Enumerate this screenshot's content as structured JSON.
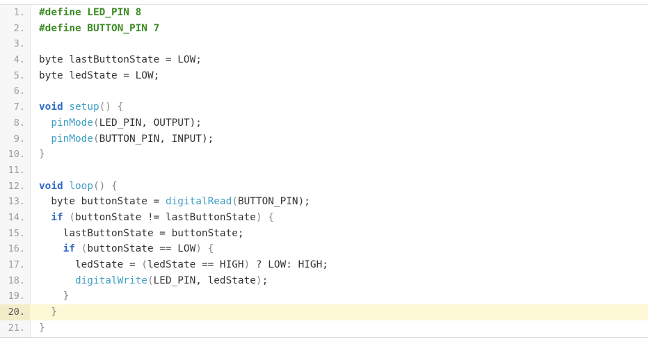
{
  "editor": {
    "active_line": 20,
    "lines": [
      {
        "n": "1.",
        "tokens": [
          {
            "t": "#define LED_PIN 8",
            "c": "dir"
          }
        ]
      },
      {
        "n": "2.",
        "tokens": [
          {
            "t": "#define BUTTON_PIN 7",
            "c": "dir"
          }
        ]
      },
      {
        "n": "3.",
        "tokens": []
      },
      {
        "n": "4.",
        "tokens": [
          {
            "t": "byte lastButtonState = LOW;",
            "c": "plain"
          }
        ]
      },
      {
        "n": "5.",
        "tokens": [
          {
            "t": "byte ledState = LOW;",
            "c": "plain"
          }
        ]
      },
      {
        "n": "6.",
        "tokens": []
      },
      {
        "n": "7.",
        "tokens": [
          {
            "t": "void",
            "c": "kw"
          },
          {
            "t": " ",
            "c": "plain"
          },
          {
            "t": "setup",
            "c": "fn"
          },
          {
            "t": "() {",
            "c": "p"
          }
        ]
      },
      {
        "n": "8.",
        "tokens": [
          {
            "t": "  ",
            "c": "plain"
          },
          {
            "t": "pinMode",
            "c": "fn"
          },
          {
            "t": "(",
            "c": "p"
          },
          {
            "t": "LED_PIN, OUTPUT",
            "c": "plain"
          },
          {
            "t": ");",
            "c": "plain"
          }
        ]
      },
      {
        "n": "9.",
        "tokens": [
          {
            "t": "  ",
            "c": "plain"
          },
          {
            "t": "pinMode",
            "c": "fn"
          },
          {
            "t": "(",
            "c": "p"
          },
          {
            "t": "BUTTON_PIN, INPUT",
            "c": "plain"
          },
          {
            "t": ");",
            "c": "plain"
          }
        ]
      },
      {
        "n": "10.",
        "tokens": [
          {
            "t": "}",
            "c": "p"
          }
        ]
      },
      {
        "n": "11.",
        "tokens": []
      },
      {
        "n": "12.",
        "tokens": [
          {
            "t": "void",
            "c": "kw"
          },
          {
            "t": " ",
            "c": "plain"
          },
          {
            "t": "loop",
            "c": "fn"
          },
          {
            "t": "() {",
            "c": "p"
          }
        ]
      },
      {
        "n": "13.",
        "tokens": [
          {
            "t": "  byte buttonState = ",
            "c": "plain"
          },
          {
            "t": "digitalRead",
            "c": "fn"
          },
          {
            "t": "(",
            "c": "p"
          },
          {
            "t": "BUTTON_PIN",
            "c": "plain"
          },
          {
            "t": ");",
            "c": "plain"
          }
        ]
      },
      {
        "n": "14.",
        "tokens": [
          {
            "t": "  ",
            "c": "plain"
          },
          {
            "t": "if",
            "c": "kw"
          },
          {
            "t": " (",
            "c": "p"
          },
          {
            "t": "buttonState != lastButtonState",
            "c": "plain"
          },
          {
            "t": ") {",
            "c": "p"
          }
        ]
      },
      {
        "n": "15.",
        "tokens": [
          {
            "t": "    lastButtonState = buttonState;",
            "c": "plain"
          }
        ]
      },
      {
        "n": "16.",
        "tokens": [
          {
            "t": "    ",
            "c": "plain"
          },
          {
            "t": "if",
            "c": "kw"
          },
          {
            "t": " (",
            "c": "p"
          },
          {
            "t": "buttonState == LOW",
            "c": "plain"
          },
          {
            "t": ") {",
            "c": "p"
          }
        ]
      },
      {
        "n": "17.",
        "tokens": [
          {
            "t": "      ledState = ",
            "c": "plain"
          },
          {
            "t": "(",
            "c": "p"
          },
          {
            "t": "ledState == HIGH",
            "c": "plain"
          },
          {
            "t": ")",
            "c": "p"
          },
          {
            "t": " ? LOW: HIGH;",
            "c": "plain"
          }
        ]
      },
      {
        "n": "18.",
        "tokens": [
          {
            "t": "      ",
            "c": "plain"
          },
          {
            "t": "digitalWrite",
            "c": "fn"
          },
          {
            "t": "(",
            "c": "p"
          },
          {
            "t": "LED_PIN, ledState",
            "c": "plain"
          },
          {
            "t": ")",
            "c": "p"
          },
          {
            "t": ";",
            "c": "plain"
          }
        ]
      },
      {
        "n": "19.",
        "tokens": [
          {
            "t": "    }",
            "c": "p"
          }
        ]
      },
      {
        "n": "20.",
        "tokens": [
          {
            "t": "  }",
            "c": "p"
          }
        ]
      },
      {
        "n": "21.",
        "tokens": [
          {
            "t": "}",
            "c": "p"
          }
        ]
      }
    ]
  },
  "colors": {
    "directive": "#3d8b25",
    "keyword": "#2f6ac9",
    "function": "#3f9fc4",
    "punctuation": "#888888",
    "text": "#333333",
    "active_line_bg": "#fdf8d5"
  }
}
